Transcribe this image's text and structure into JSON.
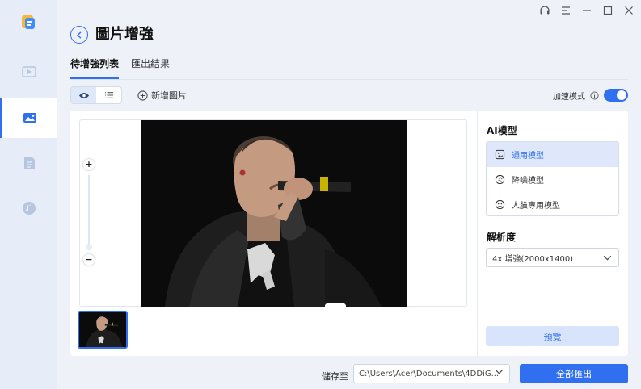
{
  "app": {
    "title": "圖片增強"
  },
  "colors": {
    "accent": "#2f6ff0",
    "sidebar_bg": "#e6edf8",
    "active_item_bg": "#dfe8fa"
  },
  "sidebar": {
    "items": [
      {
        "name": "video",
        "icon": "film-icon",
        "active": false
      },
      {
        "name": "image",
        "icon": "image-icon",
        "active": true
      },
      {
        "name": "document",
        "icon": "document-icon",
        "active": false
      },
      {
        "name": "audio",
        "icon": "music-icon",
        "active": false
      }
    ]
  },
  "window_controls": {
    "icons": [
      "headset-icon",
      "menu-icon",
      "minimize-icon",
      "maximize-icon",
      "close-icon"
    ]
  },
  "tabs": [
    {
      "label": "待增強列表",
      "active": true
    },
    {
      "label": "匯出結果",
      "active": false
    }
  ],
  "toolbar": {
    "add_label": "新增圖片",
    "speed_label": "加速模式",
    "speed_enabled": true
  },
  "zoom": {
    "plus": "+",
    "minus": "−"
  },
  "right_panel": {
    "model_title": "AI模型",
    "models": [
      {
        "label": "通用模型",
        "icon": "picture-icon",
        "active": true
      },
      {
        "label": "降噪模型",
        "icon": "noise-icon",
        "active": false
      },
      {
        "label": "人臉專用模型",
        "icon": "face-icon",
        "active": false
      }
    ],
    "resolution_title": "解析度",
    "resolution_value": "4x 增強(2000x1400)",
    "preview_label": "預覽"
  },
  "bottom": {
    "save_label": "儲存至",
    "save_path": "C:\\Users\\Acer\\Documents\\4DDiG...",
    "export_label": "全部匯出"
  }
}
